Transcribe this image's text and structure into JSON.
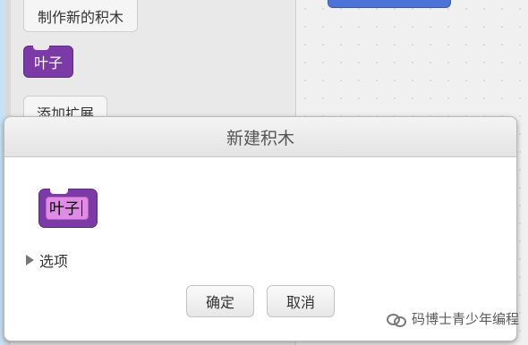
{
  "palette": {
    "make_block_label": "制作新的积木",
    "block_label": "叶子",
    "add_extension_label": "添加扩展"
  },
  "dialog": {
    "title": "新建积木",
    "preview_text": "叶子",
    "options_label": "选项",
    "ok_label": "确定",
    "cancel_label": "取消"
  },
  "watermark": {
    "text": "码博士青少年编程"
  },
  "colors": {
    "block_purple": "#7b3aa6",
    "input_pink": "#e08be6",
    "script_block_blue": "#4c74d8"
  }
}
